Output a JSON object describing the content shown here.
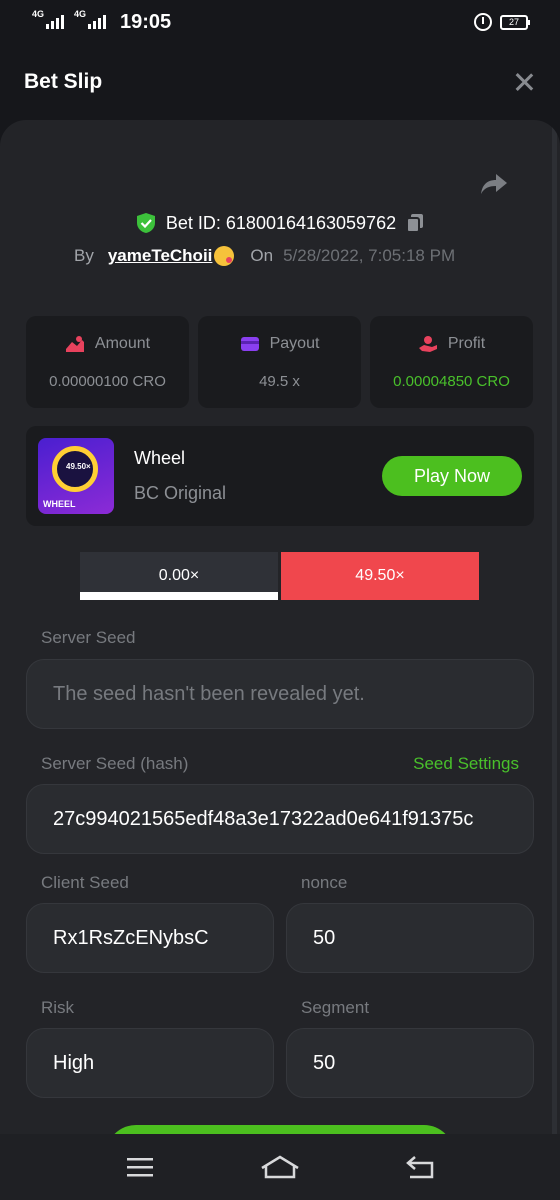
{
  "status_bar": {
    "network1": "4G",
    "network2": "4G",
    "time": "19:05",
    "battery": "27"
  },
  "header": {
    "title": "Bet Slip"
  },
  "bet": {
    "id_label": "Bet ID: 61800164163059762",
    "by_label": "By",
    "username": "yameTeChoii",
    "on_label": "On",
    "datetime": "5/28/2022, 7:05:18 PM"
  },
  "stats": [
    {
      "label": "Amount",
      "value": "0.00000100 CRO",
      "color": "#e8425d"
    },
    {
      "label": "Payout",
      "value": "49.5 x",
      "color": "#8a3ff0"
    },
    {
      "label": "Profit",
      "value": "0.00004850 CRO",
      "color": "#e8425d"
    }
  ],
  "game": {
    "name": "Wheel",
    "provider": "BC Original",
    "thumb_label": "WHEEL",
    "thumb_center": "49.50×",
    "play_label": "Play Now"
  },
  "result": {
    "left": "0.00×",
    "right": "49.50×"
  },
  "fairness": {
    "server_seed_label": "Server Seed",
    "server_seed_value": "The seed hasn't been revealed yet.",
    "server_hash_label": "Server Seed (hash)",
    "seed_settings_label": "Seed Settings",
    "server_hash_value": "27c994021565edf48a3e17322ad0e641f91375c",
    "client_seed_label": "Client Seed",
    "client_seed_value": "Rx1RsZcENybsC",
    "nonce_label": "nonce",
    "nonce_value": "50",
    "risk_label": "Risk",
    "risk_value": "High",
    "segment_label": "Segment",
    "segment_value": "50"
  },
  "colors": {
    "accent_green": "#4cbf1f",
    "loss_red": "#f0474d",
    "panel_bg": "#232428"
  }
}
